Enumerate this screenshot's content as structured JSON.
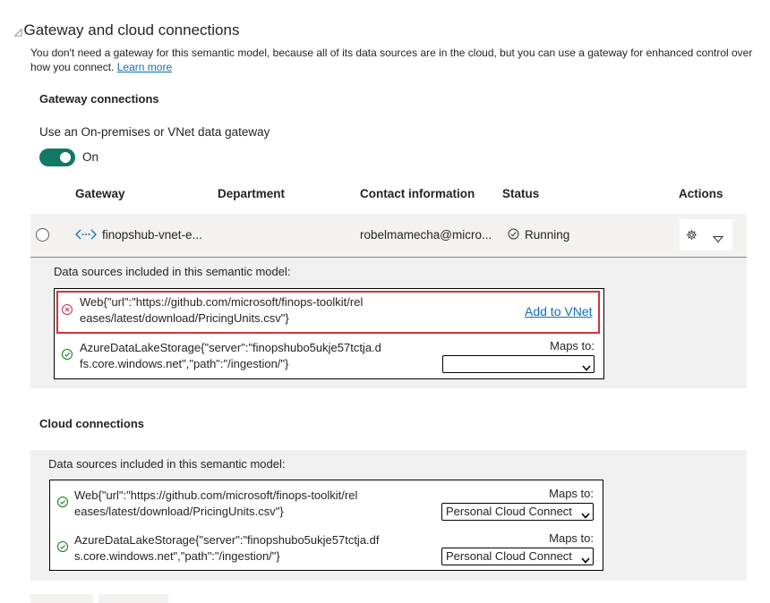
{
  "section": {
    "title": "Gateway and cloud connections",
    "description": "You don't need a gateway for this semantic model, because all of its data sources are in the cloud, but you can use a gateway for enhanced control over how you connect.",
    "learn_more": "Learn more"
  },
  "gateway": {
    "heading": "Gateway connections",
    "toggle_label": "Use an On-premises or VNet data gateway",
    "toggle_state": "On",
    "columns": [
      "Gateway",
      "Department",
      "Contact information",
      "Status",
      "Actions"
    ],
    "row": {
      "name": "finopshub-vnet-e...",
      "department": "",
      "contact": "robelmamecha@micro...",
      "status": "Running"
    },
    "panel_title": "Data sources included in this semantic model:",
    "sources": [
      {
        "line1": "Web{\"url\":\"https://github.com/microsoft/finops-toolkit/rel",
        "line2": "eases/latest/download/PricingUnits.csv\"}",
        "status": "error",
        "action": "Add to VNet"
      },
      {
        "line1": "AzureDataLakeStorage{\"server\":\"finopshubo5ukje57tctja.d",
        "line2": "fs.core.windows.net\",\"path\":\"/ingestion/\"}",
        "status": "ok",
        "maps_label": "Maps to:",
        "select_value": ""
      }
    ]
  },
  "cloud": {
    "heading": "Cloud connections",
    "panel_title": "Data sources included in this semantic model:",
    "sources": [
      {
        "line1": "Web{\"url\":\"https://github.com/microsoft/finops-toolkit/rel",
        "line2": "eases/latest/download/PricingUnits.csv\"}",
        "status": "ok",
        "maps_label": "Maps to:",
        "select_value": "Personal Cloud Connect"
      },
      {
        "line1": "AzureDataLakeStorage{\"server\":\"finopshubo5ukje57tctja.df",
        "line2": "s.core.windows.net\",\"path\":\"/ingestion/\"}",
        "status": "ok",
        "maps_label": "Maps to:",
        "select_value": "Personal Cloud Connect"
      }
    ]
  },
  "colors": {
    "toggle_on": "#117865",
    "link": "#0f6cbd",
    "error": "#c4314b",
    "success": "#107c10",
    "highlight_border": "#d13438"
  },
  "icons": {
    "section_toggle": "collapse-triangle-icon",
    "gateway_type": "vnet-icon",
    "status": "check-circle-icon",
    "settings": "gear-icon",
    "expand": "chevron-down-icon"
  }
}
